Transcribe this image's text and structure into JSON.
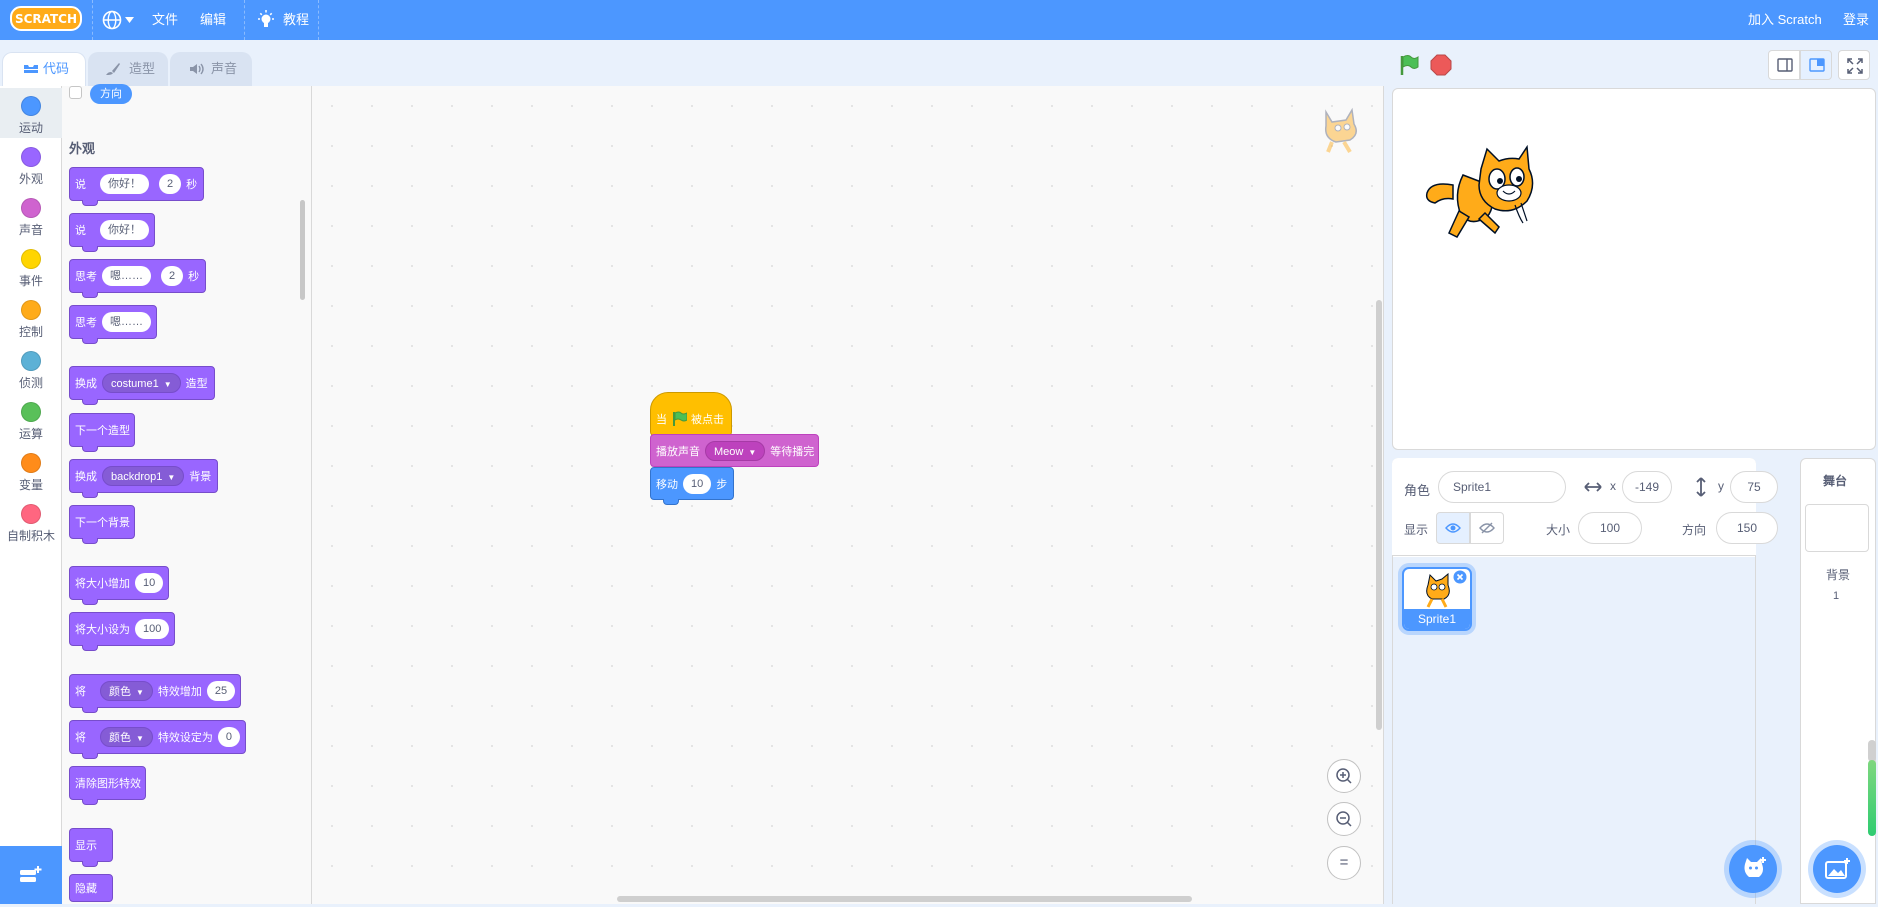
{
  "menubar": {
    "logo_text": "SCRATCH",
    "file": "文件",
    "edit": "编辑",
    "tutorials": "教程",
    "join": "加入 Scratch",
    "signin": "登录"
  },
  "tabs": [
    {
      "label": "代码"
    },
    {
      "label": "造型"
    },
    {
      "label": "声音"
    }
  ],
  "categories": [
    {
      "label": "运动",
      "color": "#4c97ff"
    },
    {
      "label": "外观",
      "color": "#9966ff"
    },
    {
      "label": "声音",
      "color": "#cf63cf"
    },
    {
      "label": "事件",
      "color": "#ffd500"
    },
    {
      "label": "控制",
      "color": "#ffab19"
    },
    {
      "label": "侦测",
      "color": "#5cb1d6"
    },
    {
      "label": "运算",
      "color": "#59c059"
    },
    {
      "label": "变量",
      "color": "#ff8c1a"
    },
    {
      "label": "自制积木",
      "color": "#ff6680"
    }
  ],
  "palette": {
    "direction_reporter": "方向",
    "looks_title": "外观",
    "blocks": {
      "say_for": {
        "word": "说",
        "text": "你好！",
        "secs": "2",
        "unit": "秒"
      },
      "say": {
        "word": "说",
        "text": "你好！"
      },
      "think_for": {
        "word": "思考",
        "text": "嗯……",
        "secs": "2",
        "unit": "秒"
      },
      "think": {
        "word": "思考",
        "text": "嗯……"
      },
      "switch_costume": {
        "word": "换成",
        "value": "costume1",
        "suffix": "造型"
      },
      "next_costume": "下一个造型",
      "switch_backdrop": {
        "word": "换成",
        "value": "backdrop1",
        "suffix": "背景"
      },
      "next_backdrop": "下一个背景",
      "change_size": {
        "text": "将大小增加",
        "value": "10"
      },
      "set_size": {
        "text": "将大小设为",
        "value": "100"
      },
      "change_effect": {
        "word": "将",
        "effect": "颜色",
        "text": "特效增加",
        "value": "25"
      },
      "set_effect": {
        "word": "将",
        "effect": "颜色",
        "text": "特效设定为",
        "value": "0"
      },
      "clear_effects": "清除图形特效",
      "show": "显示",
      "hide": "隐藏"
    }
  },
  "script": {
    "hat": {
      "prefix": "当",
      "suffix": "被点击"
    },
    "play_sound": {
      "text": "播放声音",
      "sound": "Meow",
      "suffix": "等待播完"
    },
    "move": {
      "text": "移动",
      "value": "10",
      "unit": "步"
    }
  },
  "zoom": {
    "in": "+",
    "out": "−",
    "reset": "="
  },
  "sprite_info": {
    "sprite_label": "角色",
    "sprite_name": "Sprite1",
    "x_label": "x",
    "x_value": "-149",
    "y_label": "y",
    "y_value": "75",
    "show_label": "显示",
    "size_label": "大小",
    "size_value": "100",
    "direction_label": "方向",
    "direction_value": "150"
  },
  "sprite_list": [
    {
      "name": "Sprite1"
    }
  ],
  "stage_pane": {
    "title": "舞台",
    "backdrops_label": "背景",
    "backdrops_count": "1"
  }
}
